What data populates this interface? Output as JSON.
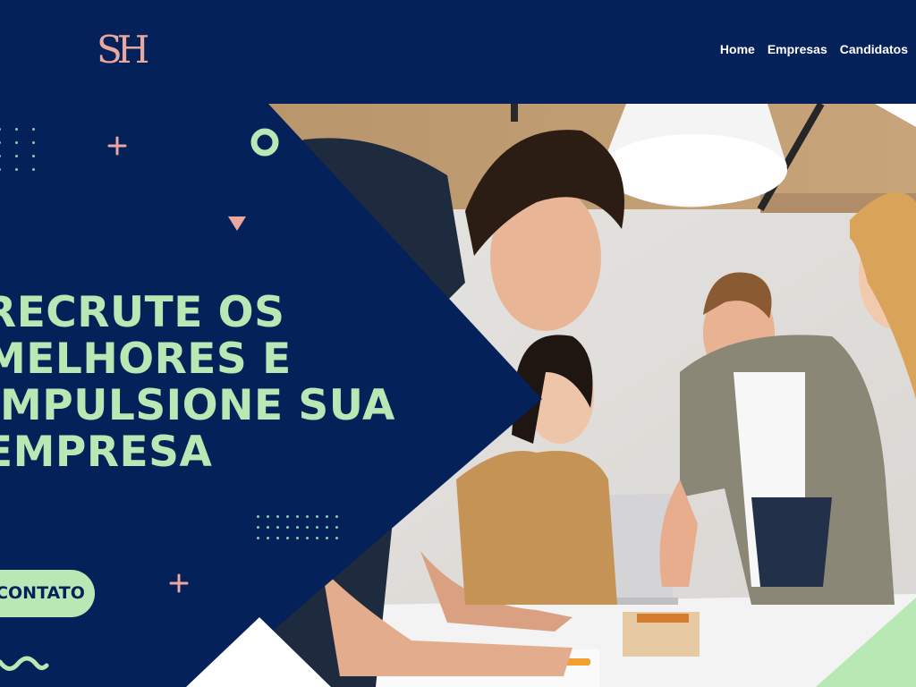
{
  "brand": {
    "logo_text": "SH"
  },
  "nav": {
    "items": [
      "Home",
      "Empresas",
      "Candidatos"
    ]
  },
  "hero": {
    "headline_lines": [
      "RECRUTE OS",
      "MELHORES E",
      "IMPULSIONE SUA",
      "EMPRESA"
    ],
    "cta_label": "CONTATO"
  },
  "colors": {
    "navy": "#05215a",
    "mint": "#b8e8b3",
    "pink": "#e9a7a0",
    "white": "#ffffff"
  },
  "icons": [
    "plus-icon",
    "ring-icon",
    "triangle-icon",
    "squiggle-icon",
    "dot-grid-icon"
  ]
}
